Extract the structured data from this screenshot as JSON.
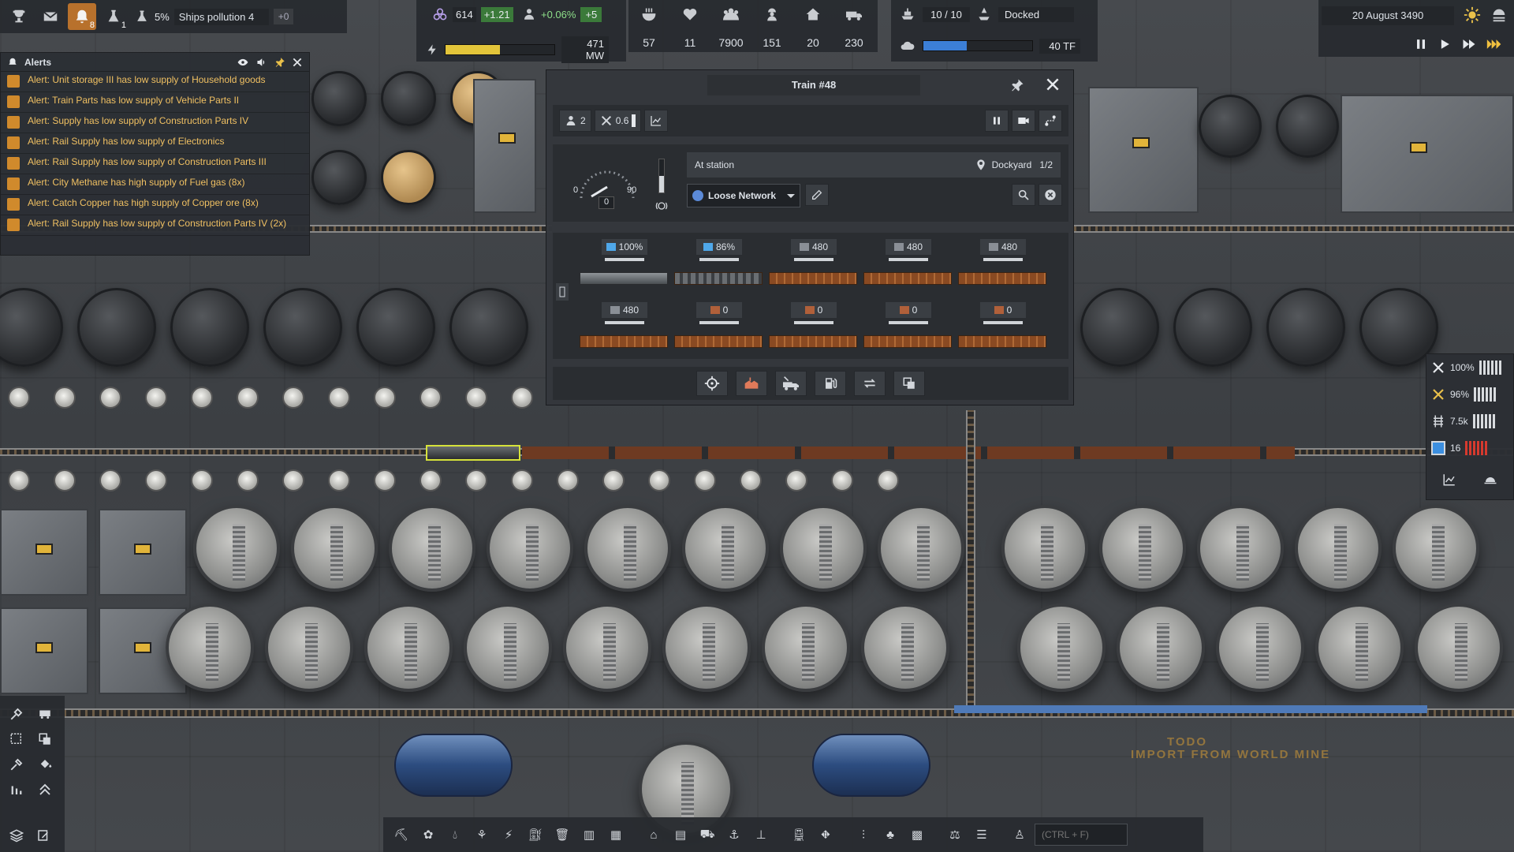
{
  "topbar": {
    "achievements_icon": "trophy-icon",
    "mail_icon": "envelope-icon",
    "notifications_count": "8",
    "research_count": "1",
    "pollution_percent": "5%",
    "pollution_label": "Ships pollution 4",
    "pollution_delta": "+0"
  },
  "resources": {
    "unity": "614",
    "unity_delta": "+1.21",
    "population_growth": "+0.06%",
    "population_delta": "+5",
    "power_used": "471 MW",
    "power_fill": 0.5
  },
  "stats": {
    "food": "57",
    "health": "11",
    "population": "7900",
    "workers": "151",
    "housing": "20",
    "vehicles": "230"
  },
  "shipyard": {
    "capacity": "10 / 10",
    "status": "Docked",
    "compute": "40 TF",
    "compute_fill": 0.4
  },
  "date": {
    "label": "20 August 3490"
  },
  "alerts": {
    "title": "Alerts",
    "items": [
      "Alert: Unit storage III has low supply of Household goods",
      "Alert: Train Parts has low supply of Vehicle Parts II",
      "Alert: Supply has low supply of Construction Parts IV",
      "Alert: Rail Supply has low supply of Electronics",
      "Alert: Rail Supply has low supply of Construction Parts III",
      "Alert: City Methane has high supply of Fuel gas (8x)",
      "Alert: Catch Copper has high supply of Copper ore (8x)",
      "Alert: Rail Supply has low supply of Construction Parts IV (2x)"
    ]
  },
  "train": {
    "title": "Train #48",
    "crew": "2",
    "maintenance": "0.6",
    "speed_current": "0",
    "speed_min": "0",
    "speed_max": "90",
    "status": "At station",
    "station": "Dockyard",
    "station_index": "1/2",
    "network": "Loose Network",
    "cars": [
      {
        "label": "100%",
        "kind": "loco"
      },
      {
        "label": "86%",
        "kind": "tender"
      },
      {
        "label": "480",
        "kind": "flat"
      },
      {
        "label": "480",
        "kind": "flat"
      },
      {
        "label": "480",
        "kind": "flat"
      },
      {
        "label": "480",
        "kind": "flat"
      },
      {
        "label": "0",
        "kind": "flat"
      },
      {
        "label": "0",
        "kind": "flat"
      },
      {
        "label": "0",
        "kind": "flat"
      },
      {
        "label": "0",
        "kind": "flat"
      }
    ]
  },
  "right_panel": {
    "maintenance_pct": "100%",
    "repair_pct": "96%",
    "rail_value": "7.5k",
    "blue_value": "16"
  },
  "bottom": {
    "search_placeholder": "(CTRL + F)"
  },
  "world": {
    "ground_text_1": "TODO",
    "ground_text_2": "IMPORT FROM WORLD MINE"
  }
}
